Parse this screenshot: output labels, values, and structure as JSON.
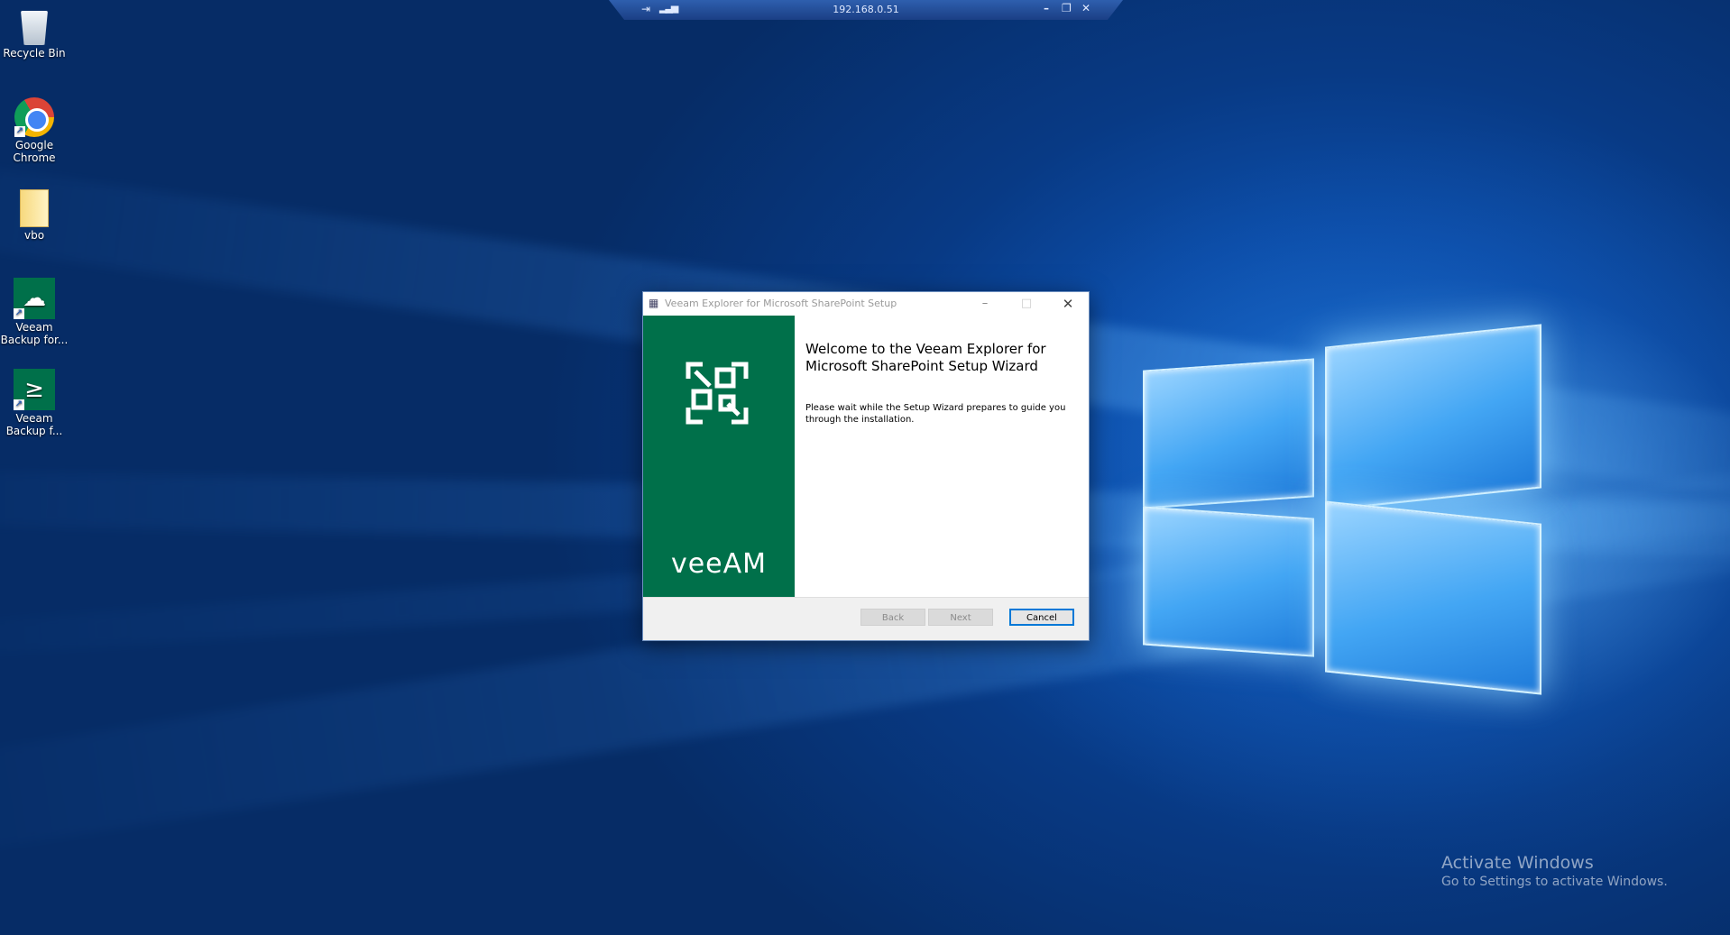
{
  "remote_bar": {
    "host": "192.168.0.51",
    "pin_icon": "pin-icon",
    "signal_icon": "signal-icon",
    "minimize_glyph": "–",
    "restore_glyph": "❐",
    "close_glyph": "✕"
  },
  "desktop_icons": [
    {
      "label": "Recycle Bin",
      "icon": "recycle-bin-icon"
    },
    {
      "label": "Google Chrome",
      "icon": "chrome-icon"
    },
    {
      "label": "vbo",
      "icon": "folder-icon"
    },
    {
      "label": "Veeam Backup for...",
      "icon": "veeam-backup-icon"
    },
    {
      "label": "Veeam Backup f...",
      "icon": "veeam-powershell-icon"
    }
  ],
  "setup_window": {
    "title": "Veeam Explorer for Microsoft SharePoint Setup",
    "heading": "Welcome to the Veeam Explorer for Microsoft SharePoint Setup Wizard",
    "description": "Please wait while the Setup Wizard prepares to guide you through the installation.",
    "brand_wordmark": "veeAM",
    "buttons": {
      "back": "Back",
      "next": "Next",
      "cancel": "Cancel"
    },
    "brand_color": "#00704a"
  },
  "watermark": {
    "title": "Activate Windows",
    "subtitle": "Go to Settings to activate Windows."
  }
}
